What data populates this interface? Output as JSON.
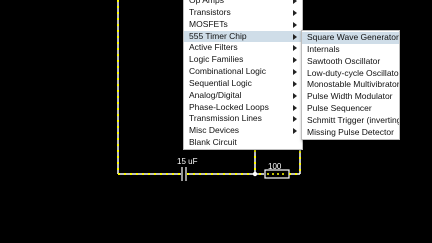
{
  "circuit": {
    "capacitor_label": "15 uF",
    "resistor_label": "100"
  },
  "main_menu": {
    "items": [
      {
        "label": "Op Amps",
        "has_submenu": true
      },
      {
        "label": "Transistors",
        "has_submenu": true
      },
      {
        "label": "MOSFETs",
        "has_submenu": true
      },
      {
        "label": "555 Timer Chip",
        "has_submenu": true,
        "selected": true
      },
      {
        "label": "Active Filters",
        "has_submenu": true
      },
      {
        "label": "Logic Families",
        "has_submenu": true
      },
      {
        "label": "Combinational Logic",
        "has_submenu": true
      },
      {
        "label": "Sequential Logic",
        "has_submenu": true
      },
      {
        "label": "Analog/Digital",
        "has_submenu": true
      },
      {
        "label": "Phase-Locked Loops",
        "has_submenu": true
      },
      {
        "label": "Transmission Lines",
        "has_submenu": true
      },
      {
        "label": "Misc Devices",
        "has_submenu": true
      },
      {
        "label": "Blank Circuit",
        "has_submenu": false
      }
    ]
  },
  "sub_menu": {
    "items": [
      {
        "label": "Square Wave Generator",
        "selected": true
      },
      {
        "label": "Internals"
      },
      {
        "label": "Sawtooth Oscillator"
      },
      {
        "label": "Low-duty-cycle Oscillator"
      },
      {
        "label": "Monostable Multivibrator"
      },
      {
        "label": "Pulse Width Modulator"
      },
      {
        "label": "Pulse Sequencer"
      },
      {
        "label": "Schmitt Trigger (inverting)"
      },
      {
        "label": "Missing Pulse Detector"
      }
    ]
  },
  "colors": {
    "background": "#000000",
    "wire": "#ffffff",
    "wire_dots": "#ffff00",
    "menu_background": "#ffffff",
    "menu_selected": "#cfdde8"
  }
}
